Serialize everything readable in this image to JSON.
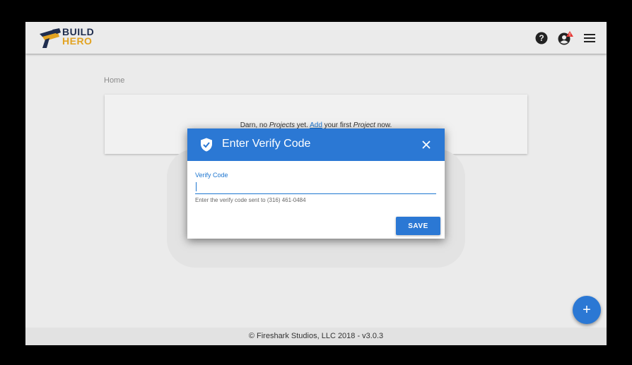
{
  "header": {
    "logo_line1": "BUILD",
    "logo_line2": "HERO",
    "icons": [
      "help-icon",
      "account-alert-icon",
      "menu-icon"
    ]
  },
  "breadcrumb": "Home",
  "empty_state": {
    "prefix": "Darn, no ",
    "projects_word": "Projects",
    "middle": " yet. ",
    "add_link": "Add",
    "after_link": " your first ",
    "project_word": "Project",
    "suffix": " now."
  },
  "dialog": {
    "title": "Enter Verify Code",
    "field_label": "Verify Code",
    "field_value": "",
    "helper_text": "Enter the verify code sent to (316) 461-0484",
    "save_label": "SAVE"
  },
  "fab_label": "+",
  "footer": "© Fireshark Studios, LLC 2018 - v3.0.3",
  "colors": {
    "primary": "#2b78d4",
    "logo_dark": "#1f2d4e",
    "logo_gold": "#e2a322",
    "alert_badge": "#e53935"
  }
}
